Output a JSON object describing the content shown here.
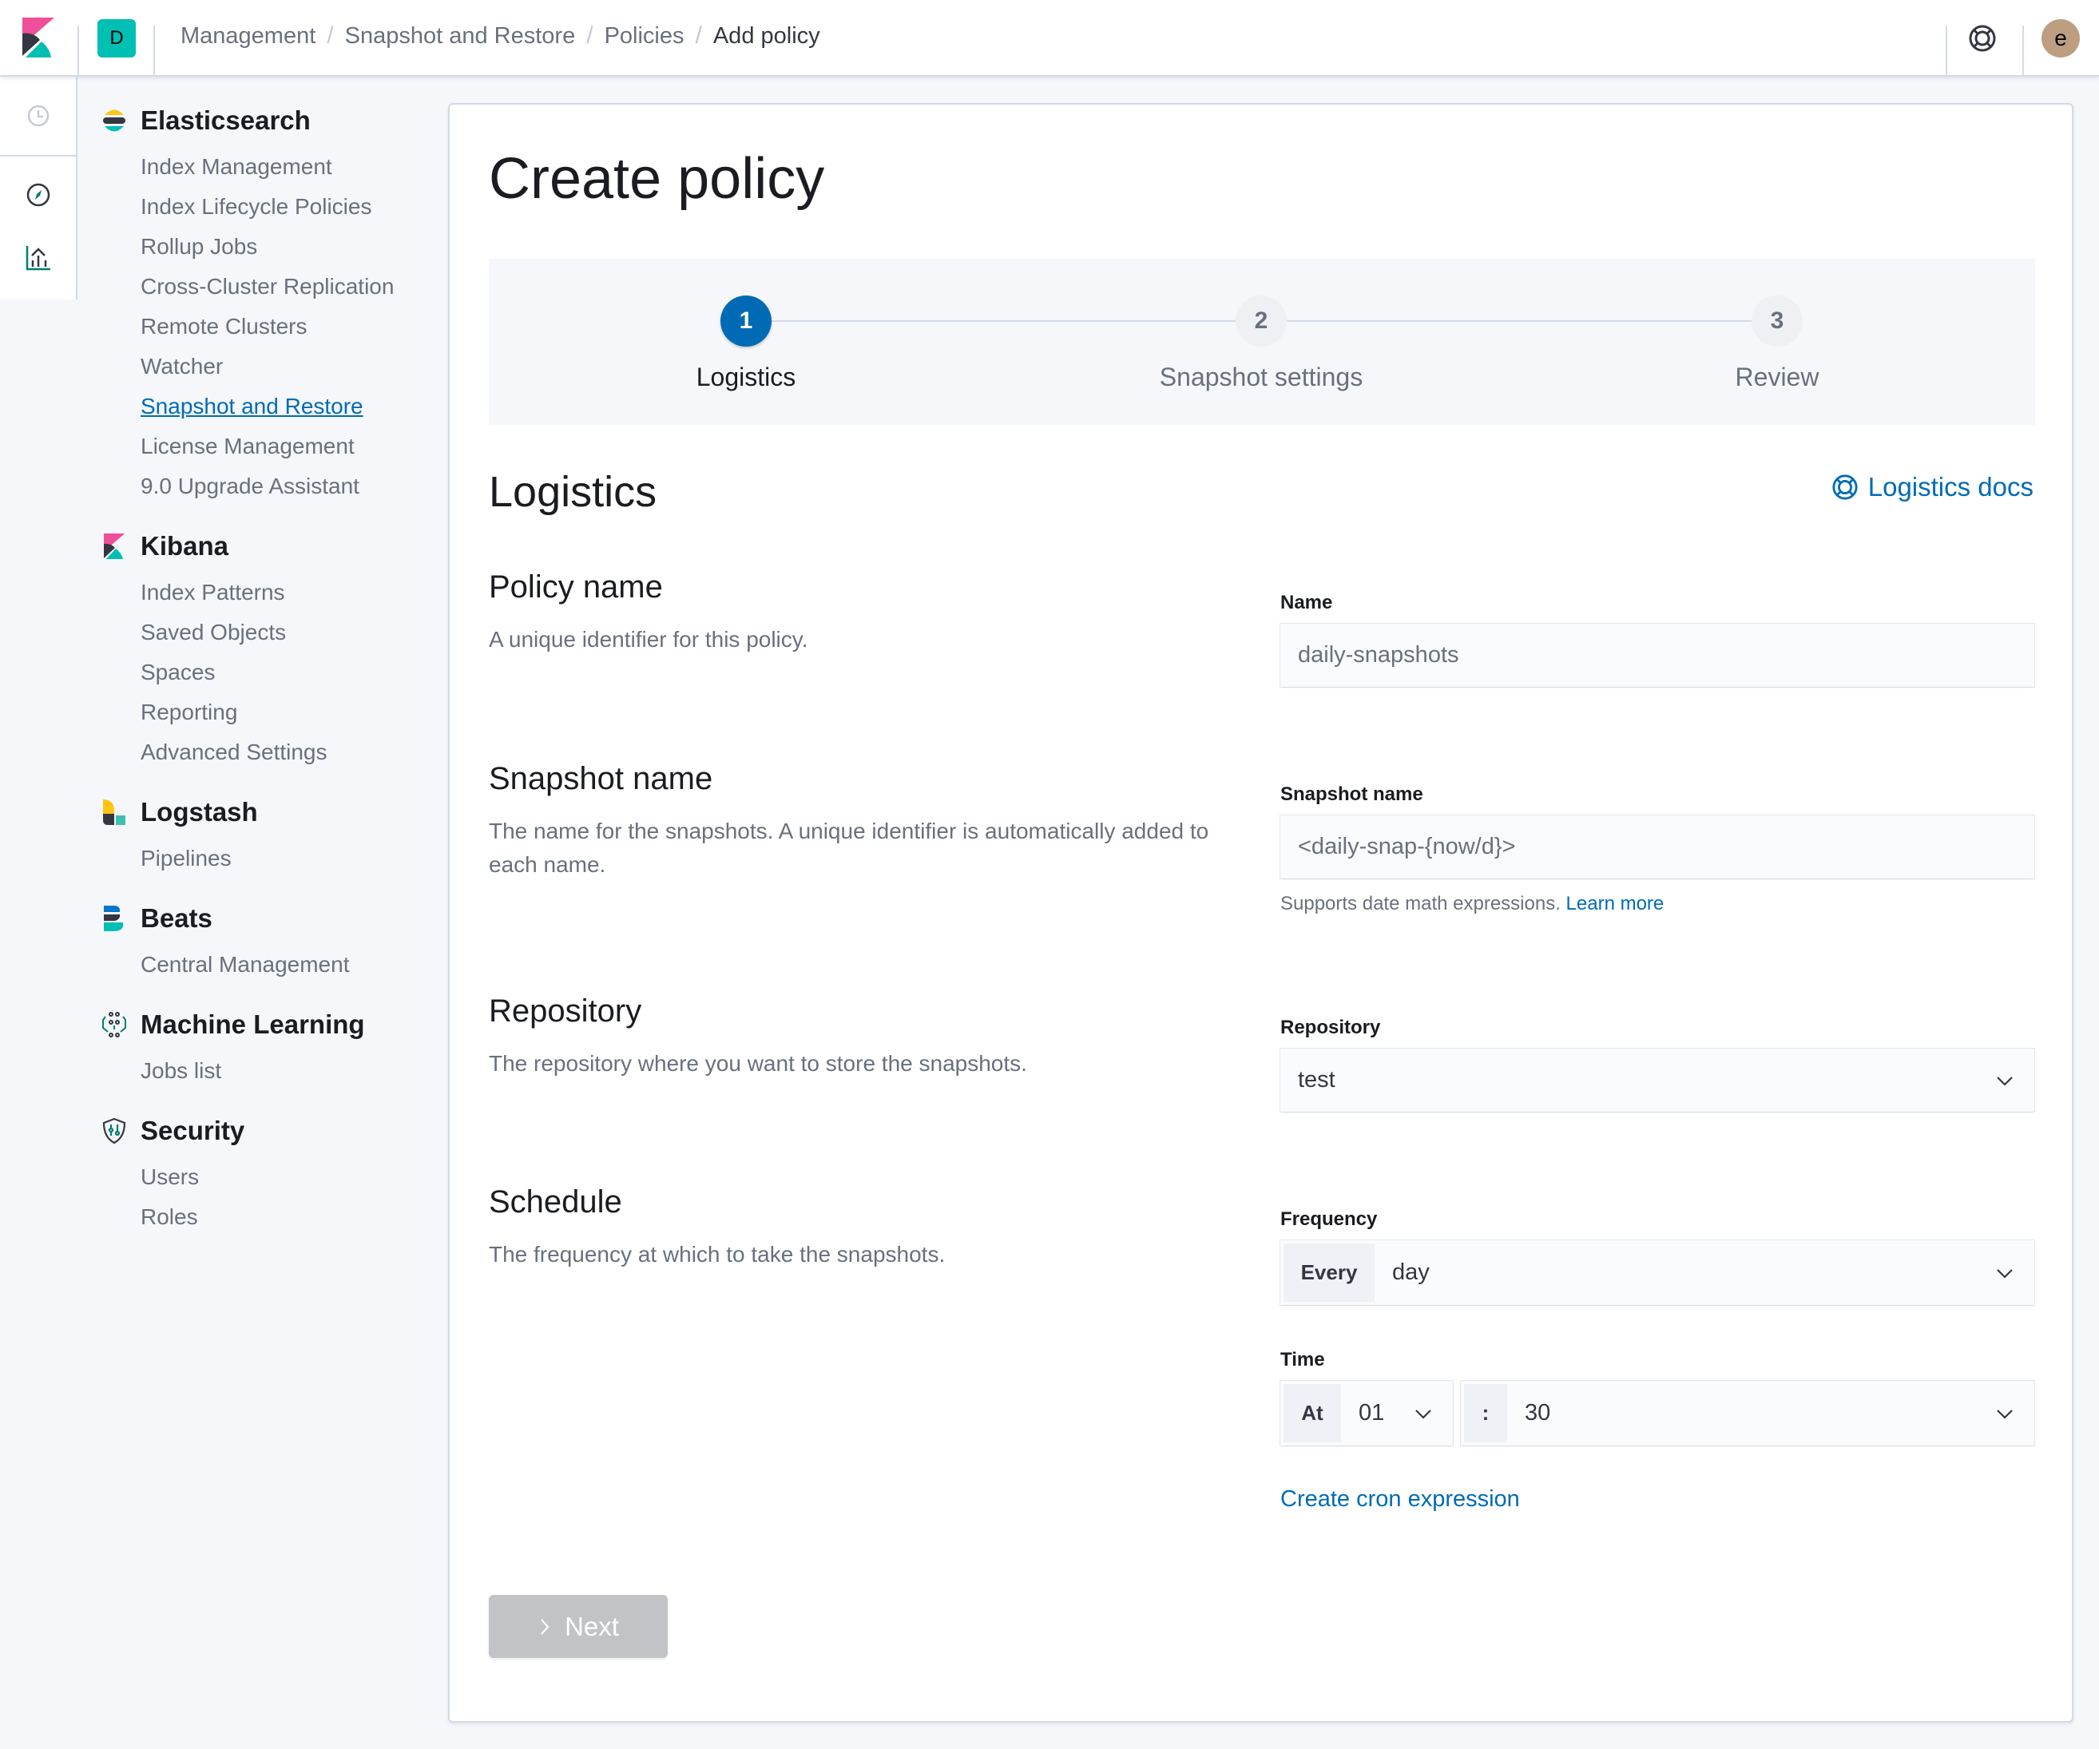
{
  "header": {
    "space_initial": "D",
    "breadcrumbs": [
      "Management",
      "Snapshot and Restore",
      "Policies",
      "Add policy"
    ],
    "user_initial": "e",
    "icons": {
      "logo": "kibana-logo-icon",
      "help": "help-lifebuoy-icon"
    }
  },
  "rail": {
    "icons": [
      "recently-viewed-clock-icon",
      "discover-compass-icon",
      "visualize-chart-icon"
    ]
  },
  "sidenav": {
    "groups": [
      {
        "title": "Elasticsearch",
        "icon": "elasticsearch-logo-icon",
        "items": [
          "Index Management",
          "Index Lifecycle Policies",
          "Rollup Jobs",
          "Cross-Cluster Replication",
          "Remote Clusters",
          "Watcher",
          "Snapshot and Restore",
          "License Management",
          "9.0 Upgrade Assistant"
        ]
      },
      {
        "title": "Kibana",
        "icon": "kibana-logo-icon",
        "items": [
          "Index Patterns",
          "Saved Objects",
          "Spaces",
          "Reporting",
          "Advanced Settings"
        ]
      },
      {
        "title": "Logstash",
        "icon": "logstash-logo-icon",
        "items": [
          "Pipelines"
        ]
      },
      {
        "title": "Beats",
        "icon": "beats-logo-icon",
        "items": [
          "Central Management"
        ]
      },
      {
        "title": "Machine Learning",
        "icon": "machine-learning-icon",
        "items": [
          "Jobs list"
        ]
      },
      {
        "title": "Security",
        "icon": "security-shield-icon",
        "items": [
          "Users",
          "Roles"
        ]
      }
    ],
    "active_item": "Snapshot and Restore"
  },
  "page": {
    "title": "Create policy",
    "steps": [
      {
        "number": "1",
        "label": "Logistics",
        "state": "active"
      },
      {
        "number": "2",
        "label": "Snapshot settings",
        "state": "todo"
      },
      {
        "number": "3",
        "label": "Review",
        "state": "todo"
      }
    ],
    "section_title": "Logistics",
    "docs_link": "Logistics docs",
    "policy_name": {
      "heading": "Policy name",
      "description": "A unique identifier for this policy.",
      "label": "Name",
      "value": "daily-snapshots"
    },
    "snapshot_name": {
      "heading": "Snapshot name",
      "description": "The name for the snapshots. A unique identifier is automatically added to each name.",
      "label": "Snapshot name",
      "value": "<daily-snap-{now/d}>",
      "help_text": "Supports date math expressions.",
      "help_link": "Learn more"
    },
    "repository": {
      "heading": "Repository",
      "description": "The repository where you want to store the snapshots.",
      "label": "Repository",
      "value": "test"
    },
    "schedule": {
      "heading": "Schedule",
      "description": "The frequency at which to take the snapshots.",
      "frequency_label": "Frequency",
      "frequency_prepend": "Every",
      "frequency_value": "day",
      "time_label": "Time",
      "hour_prepend": "At",
      "hour_value": "01",
      "minute_prepend": ":",
      "minute_value": "30",
      "cron_link": "Create cron expression"
    },
    "next_button": "Next",
    "colors": {
      "primary": "#006bb4",
      "disabled_button": "#c2c3c6",
      "space_avatar": "#00bfb3",
      "user_avatar": "#bd9e81"
    }
  }
}
